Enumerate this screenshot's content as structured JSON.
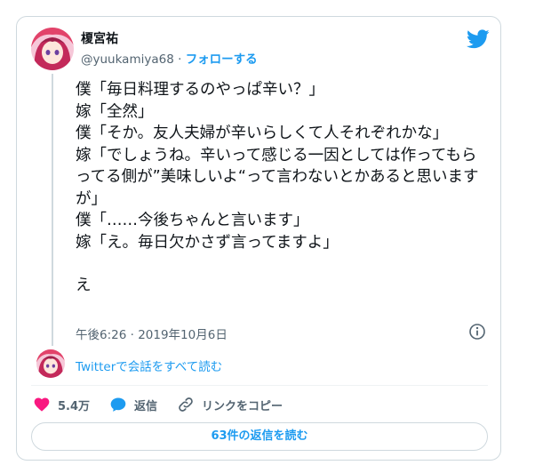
{
  "author": {
    "name": "榎宮祐",
    "handle": "@yuukamiya68",
    "separator": "·",
    "follow_label": "フォローする"
  },
  "tweet": {
    "lines": [
      "僕「毎日料理するのやっぱ辛い？」",
      "嫁「全然」",
      "僕「そか。友人夫婦が辛いらしくて人それぞれかな」",
      "嫁「でしょうね。辛いって感じる一因としては作ってもらってる側が”美味しいよ“って言わないとかあると思いますが」",
      "僕「……今後ちゃんと言います」",
      "嫁「え。毎日欠かさず言ってますよ」"
    ],
    "last_line": "え",
    "timestamp": "午後6:26 · 2019年10月6日"
  },
  "thread": {
    "read_more_label": "Twitterで会話をすべて読む"
  },
  "actions": {
    "likes": "5.4万",
    "reply_label": "返信",
    "copy_link_label": "リンクをコピー"
  },
  "replies_button": {
    "label": "63件の返信を読む"
  },
  "colors": {
    "accent": "#1d9bf0",
    "like": "#f91880",
    "text": "#0f1419",
    "secondary": "#536471",
    "border": "#cfd9de"
  },
  "icons": [
    "twitter-bird-icon",
    "info-icon",
    "heart-icon",
    "reply-bubble-icon",
    "link-icon"
  ]
}
